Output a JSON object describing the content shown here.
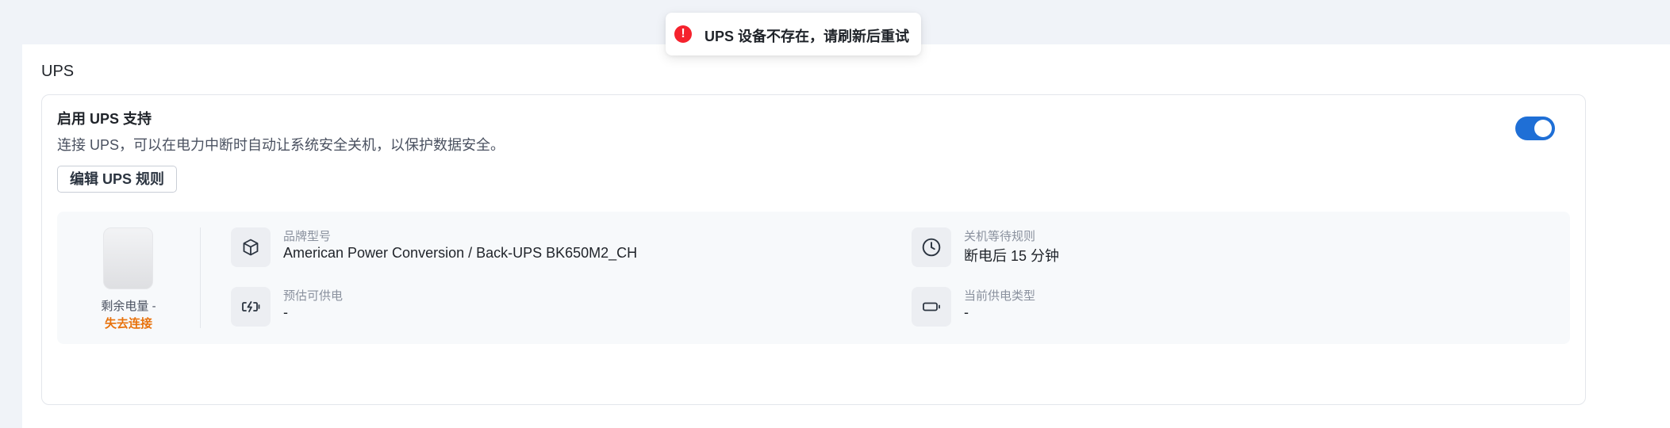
{
  "toast": {
    "message": "UPS 设备不存在，请刷新后重试",
    "icon": "error-icon",
    "color": "#f5222d"
  },
  "section": {
    "title": "UPS"
  },
  "ups_card": {
    "title": "启用 UPS 支持",
    "description": "连接 UPS，可以在电力中断时自动让系统安全关机，以保护数据安全。",
    "edit_button": "编辑 UPS 规则",
    "enabled": true,
    "accent_color": "#1f6fd6"
  },
  "battery": {
    "label": "剩余电量 -",
    "status": "失去连接",
    "status_color": "#e8720c"
  },
  "info": [
    {
      "icon": "box-icon",
      "label": "品牌型号",
      "value": "American Power Conversion / Back-UPS BK650M2_CH"
    },
    {
      "icon": "clock-icon",
      "label": "关机等待规则",
      "value": "断电后 15 分钟"
    },
    {
      "icon": "battery-charging-icon",
      "label": "预估可供电",
      "value": "-"
    },
    {
      "icon": "battery-icon",
      "label": "当前供电类型",
      "value": "-"
    }
  ]
}
